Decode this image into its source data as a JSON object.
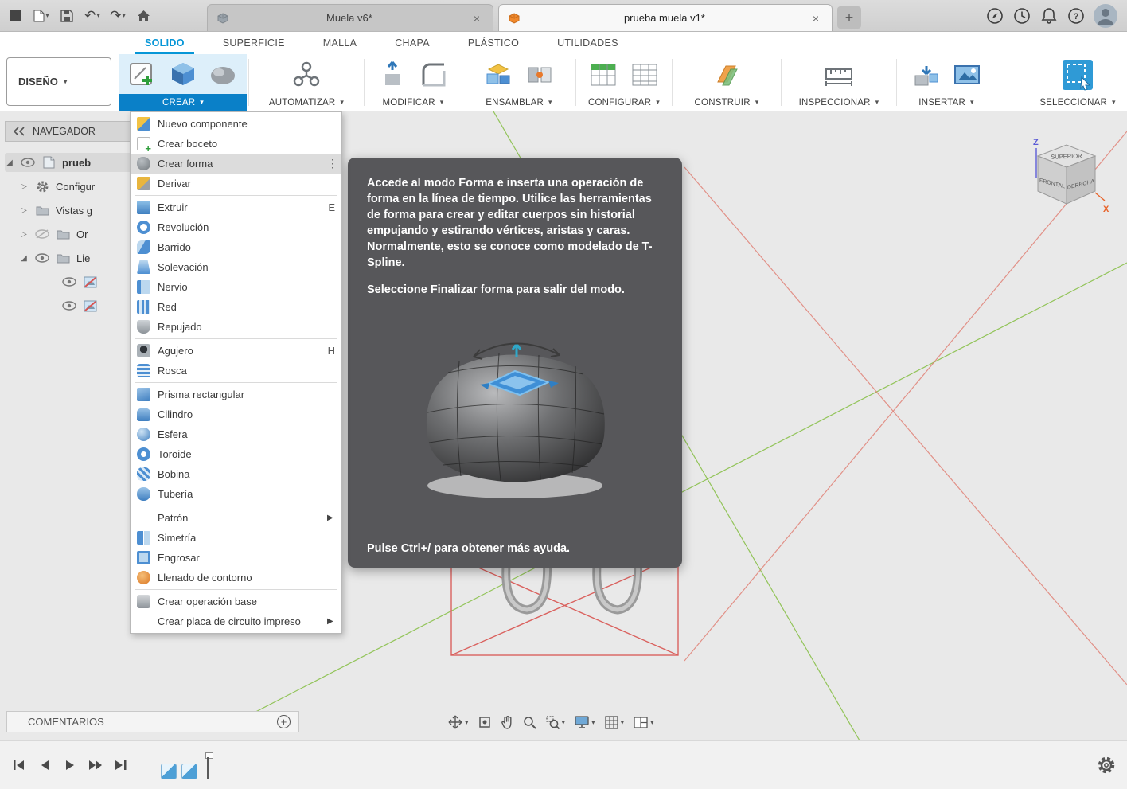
{
  "colors": {
    "accent": "#0a80c8",
    "accent2": "#0696d7",
    "tooltip_bg": "#57575a",
    "canvas_bg": "#e9e9e9"
  },
  "titlebar": {
    "tabs": [
      {
        "label": "Muela v6*"
      },
      {
        "label": "prueba muela v1*"
      }
    ],
    "close_glyph": "×",
    "newtab_glyph": "+"
  },
  "ribbon": {
    "design_label": "DISEÑO",
    "tabs": [
      "SOLIDO",
      "SUPERFICIE",
      "MALLA",
      "CHAPA",
      "PLÁSTICO",
      "UTILIDADES"
    ],
    "active_tab": "SOLIDO",
    "groups": [
      {
        "label": "CREAR"
      },
      {
        "label": "AUTOMATIZAR"
      },
      {
        "label": "MODIFICAR"
      },
      {
        "label": "ENSAMBLAR"
      },
      {
        "label": "CONFIGURAR"
      },
      {
        "label": "CONSTRUIR"
      },
      {
        "label": "INSPECCIONAR"
      },
      {
        "label": "INSERTAR"
      },
      {
        "label": "SELECCIONAR"
      }
    ]
  },
  "menu": {
    "items": [
      {
        "label": "Nuevo componente"
      },
      {
        "label": "Crear boceto"
      },
      {
        "label": "Crear forma",
        "highlighted": true
      },
      {
        "label": "Derivar"
      },
      {
        "label": "Extruir",
        "shortcut": "E"
      },
      {
        "label": "Revolución"
      },
      {
        "label": "Barrido"
      },
      {
        "label": "Solevación"
      },
      {
        "label": "Nervio"
      },
      {
        "label": "Red"
      },
      {
        "label": "Repujado"
      },
      {
        "label": "Agujero",
        "shortcut": "H"
      },
      {
        "label": "Rosca"
      },
      {
        "label": "Prisma rectangular"
      },
      {
        "label": "Cilindro"
      },
      {
        "label": "Esfera"
      },
      {
        "label": "Toroide"
      },
      {
        "label": "Bobina"
      },
      {
        "label": "Tubería"
      },
      {
        "label": "Patrón",
        "submenu": true
      },
      {
        "label": "Simetría"
      },
      {
        "label": "Engrosar"
      },
      {
        "label": "Llenado de contorno"
      },
      {
        "label": "Crear operación base"
      },
      {
        "label": "Crear placa de circuito impreso",
        "submenu": true
      }
    ]
  },
  "tooltip": {
    "paragraph1": "Accede al modo Forma e inserta una operación de forma en la línea de tiempo. Utilice las herramientas de forma para crear y editar cuerpos sin historial empujando y estirando vértices, aristas y caras. Normalmente, esto se conoce como modelado de T-Spline.",
    "paragraph2": "Seleccione Finalizar forma para salir del modo.",
    "footer": "Pulse Ctrl+/ para obtener más ayuda."
  },
  "navigator": {
    "title": "NAVEGADOR",
    "rows": [
      {
        "label": "prueb"
      },
      {
        "label": "Configur"
      },
      {
        "label": "Vistas g"
      },
      {
        "label": "Or"
      },
      {
        "label": "Lie"
      }
    ]
  },
  "viewcube": {
    "top": "SUPERIOR",
    "front": "FRONTAL",
    "right": "DERECHA",
    "z_axis": "Z",
    "x_axis": "X"
  },
  "comments": {
    "label": "COMENTARIOS"
  }
}
